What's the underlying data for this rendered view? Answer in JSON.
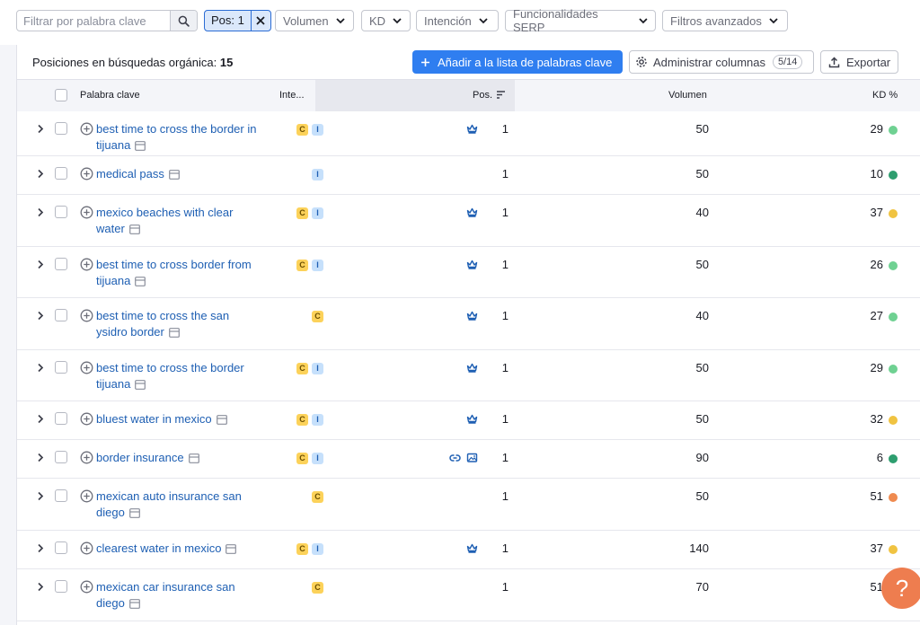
{
  "filters": {
    "search_placeholder": "Filtrar por palabra clave",
    "pos_chip": "Pos: 1",
    "dropdowns": [
      "Volumen",
      "KD",
      "Intención",
      "Funcionalidades SERP",
      "Filtros avanzados"
    ]
  },
  "toolbar": {
    "title_prefix": "Posiciones en búsquedas orgánica:",
    "title_count": "15",
    "add_label": "Añadir a la lista de palabras clave",
    "columns_label": "Administrar columnas",
    "columns_count": "5/14",
    "export_label": "Exportar"
  },
  "columns": {
    "keyword": "Palabra clave",
    "intent": "Inte...",
    "pos": "Pos.",
    "volume": "Volumen",
    "kd": "KD %"
  },
  "colors": {
    "kd_easy": "#6fd192",
    "kd_very_easy": "#2e9e6f",
    "kd_possible": "#f0c341",
    "kd_difficult": "#ef8a4f",
    "accent": "#2f7ef0"
  },
  "rows": [
    {
      "lines": [
        "best time to cross the border in",
        "tijuana"
      ],
      "intent": [
        "C",
        "I"
      ],
      "serp": [
        "crown-icon"
      ],
      "pos": "1",
      "volume": "50",
      "kd": "29",
      "kd_color": "#6fd192"
    },
    {
      "lines": [
        "medical pass"
      ],
      "intent": [
        "I"
      ],
      "serp": [],
      "pos": "1",
      "volume": "50",
      "kd": "10",
      "kd_color": "#2e9e6f"
    },
    {
      "lines": [
        "mexico beaches with clear",
        "water"
      ],
      "intent": [
        "C",
        "I"
      ],
      "serp": [
        "crown-icon"
      ],
      "pos": "1",
      "volume": "40",
      "kd": "37",
      "kd_color": "#f0c341"
    },
    {
      "lines": [
        "best time to cross border from",
        "tijuana"
      ],
      "intent": [
        "C",
        "I"
      ],
      "serp": [
        "crown-icon"
      ],
      "pos": "1",
      "volume": "50",
      "kd": "26",
      "kd_color": "#6fd192"
    },
    {
      "lines": [
        "best time to cross the san",
        "ysidro border"
      ],
      "intent": [
        "C"
      ],
      "serp": [
        "crown-icon"
      ],
      "pos": "1",
      "volume": "40",
      "kd": "27",
      "kd_color": "#6fd192"
    },
    {
      "lines": [
        "best time to cross the border",
        "tijuana"
      ],
      "intent": [
        "C",
        "I"
      ],
      "serp": [
        "crown-icon"
      ],
      "pos": "1",
      "volume": "50",
      "kd": "29",
      "kd_color": "#6fd192"
    },
    {
      "lines": [
        "bluest water in mexico"
      ],
      "intent": [
        "C",
        "I"
      ],
      "serp": [
        "crown-icon"
      ],
      "pos": "1",
      "volume": "50",
      "kd": "32",
      "kd_color": "#f0c341"
    },
    {
      "lines": [
        "border insurance"
      ],
      "intent": [
        "C",
        "I"
      ],
      "serp": [
        "link-icon",
        "image-icon"
      ],
      "pos": "1",
      "volume": "90",
      "kd": "6",
      "kd_color": "#2e9e6f"
    },
    {
      "lines": [
        "mexican auto insurance san",
        "diego"
      ],
      "intent": [
        "C"
      ],
      "serp": [],
      "pos": "1",
      "volume": "50",
      "kd": "51",
      "kd_color": "#ef8a4f"
    },
    {
      "lines": [
        "clearest water in mexico"
      ],
      "intent": [
        "C",
        "I"
      ],
      "serp": [
        "crown-icon"
      ],
      "pos": "1",
      "volume": "140",
      "kd": "37",
      "kd_color": "#f0c341"
    },
    {
      "lines": [
        "mexican car insurance san",
        "diego"
      ],
      "intent": [
        "C"
      ],
      "serp": [],
      "pos": "1",
      "volume": "70",
      "kd": "51",
      "kd_color": "#ef8a4f"
    }
  ]
}
